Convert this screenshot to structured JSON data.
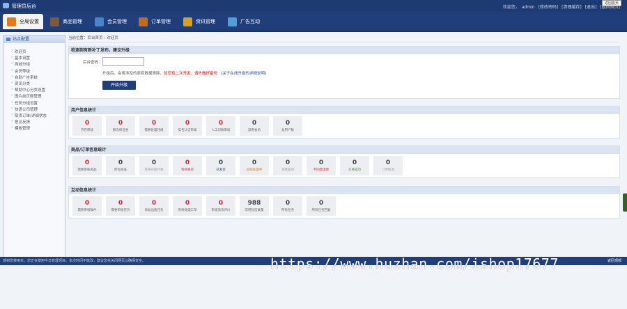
{
  "app": {
    "title": "管理员后台"
  },
  "user": {
    "greeting": "欢迎您，",
    "name": "admin",
    "links": [
      "[修改密码]",
      "[清理缓存]",
      "[退出]",
      "[返回首页]"
    ],
    "tooltip": "返回首页"
  },
  "nav": [
    {
      "label": "全局设置",
      "color": "#e07b1a"
    },
    {
      "label": "商品管理",
      "color": "#7a5a3b"
    },
    {
      "label": "会员管理",
      "color": "#4a86c7"
    },
    {
      "label": "订单管理",
      "color": "#c56a1b"
    },
    {
      "label": "资讯管理",
      "color": "#d6a21c"
    },
    {
      "label": "广告互动",
      "color": "#4fa0d9"
    }
  ],
  "sidebar": {
    "title": "站点配置",
    "items": [
      "欢迎页",
      "基本设置",
      "商城分组",
      "会员等级",
      "自助广告系统",
      "资讯分类",
      "帮助中心分类设置",
      "图片前页面管理",
      "任务分组设置",
      "快递公司管理",
      "取货订单/详细状态",
      "意见反馈",
      "模板管理"
    ]
  },
  "breadcrumb": "当前位置：后台首页 › 欢迎页",
  "upgrade": {
    "title": "检测到有新补丁发布，建议升级",
    "pwd_label": "后台密码：",
    "note_plain": "升级后，会将涉及的原有数据清除，",
    "note_red": "如您有二次开发，请先做好备份",
    "note_link": "[关于在线升级的详细说明]",
    "button": "开始升级"
  },
  "user_stats": {
    "title": "用户信息统计",
    "items": [
      {
        "value": "0",
        "label": "开店审核",
        "color": "#e3242b"
      },
      {
        "value": "0",
        "label": "解冻保证金",
        "color": "#e3242b"
      },
      {
        "value": "0",
        "label": "需要处理违规",
        "color": "#e3242b"
      },
      {
        "value": "0",
        "label": "实名认证审核",
        "color": "#e3242b"
      },
      {
        "value": "0",
        "label": "人工对账审核",
        "color": "#e3242b"
      },
      {
        "value": "0",
        "label": "禁用会员",
        "color": "#444444"
      },
      {
        "value": "0",
        "label": "总用户数",
        "color": "#444444"
      }
    ]
  },
  "order_stats": {
    "title": "商品/订单信息统计",
    "items": [
      {
        "value": "0",
        "label": "需要审核商品",
        "color": "#e3242b",
        "label_color": "#666666"
      },
      {
        "value": "0",
        "label": "所有商品",
        "color": "#444444",
        "label_color": "#666666"
      },
      {
        "value": "0",
        "label": "等待买家付款",
        "color": "#444444",
        "label_color": "#999999"
      },
      {
        "value": "0",
        "label": "等待发货",
        "color": "#e3242b",
        "label_color": "#e3242b"
      },
      {
        "value": "0",
        "label": "已发货",
        "color": "#444444",
        "label_color": "#1b46b3"
      },
      {
        "value": "0",
        "label": "退款处理中",
        "color": "#444444",
        "label_color": "#e07b1a"
      },
      {
        "value": "0",
        "label": "退款成功",
        "color": "#444444",
        "label_color": "#999999"
      },
      {
        "value": "0",
        "label": "不同意退款",
        "color": "#444444",
        "label_color": "#e3242b"
      },
      {
        "value": "0",
        "label": "交易成功",
        "color": "#444444",
        "label_color": "#2e9e2e"
      },
      {
        "value": "0",
        "label": "订单取消",
        "color": "#444444",
        "label_color": "#999999"
      }
    ]
  },
  "interaction_stats": {
    "title": "互动信息统计",
    "items": [
      {
        "value": "0",
        "label": "需要审核稿件",
        "color": "#e3242b"
      },
      {
        "value": "0",
        "label": "需要审核任务",
        "color": "#e3242b"
      },
      {
        "value": "0",
        "label": "商标出售任务",
        "color": "#e3242b"
      },
      {
        "value": "0",
        "label": "等待处理工单",
        "color": "#e3242b"
      },
      {
        "value": "0",
        "label": "审核资讯评价",
        "color": "#e3242b"
      },
      {
        "value": "988",
        "label": "可用短信数量",
        "color": "#444444"
      },
      {
        "value": "0",
        "label": "所有任务",
        "color": "#444444"
      },
      {
        "value": "0",
        "label": "所有任务回复",
        "color": "#444444"
      }
    ]
  },
  "footer": {
    "left": "感谢您使用本，您正在使用今日管理顶目。本次时间不能改，建议您先关闭网页以确保安全。",
    "right": "返回顶部"
  },
  "watermark": "https://www.huzhan.com/ishop17677"
}
